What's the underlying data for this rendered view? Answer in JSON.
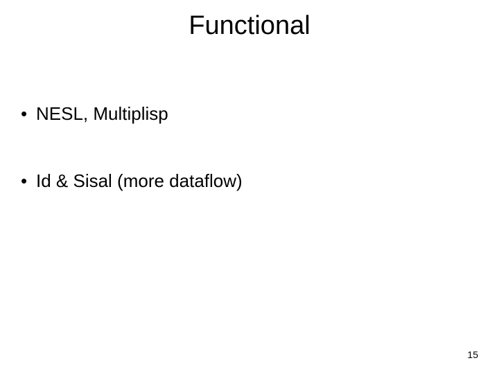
{
  "title": "Functional",
  "bullets": [
    "NESL, Multiplisp",
    "Id & Sisal (more dataflow)"
  ],
  "page_number": "15"
}
